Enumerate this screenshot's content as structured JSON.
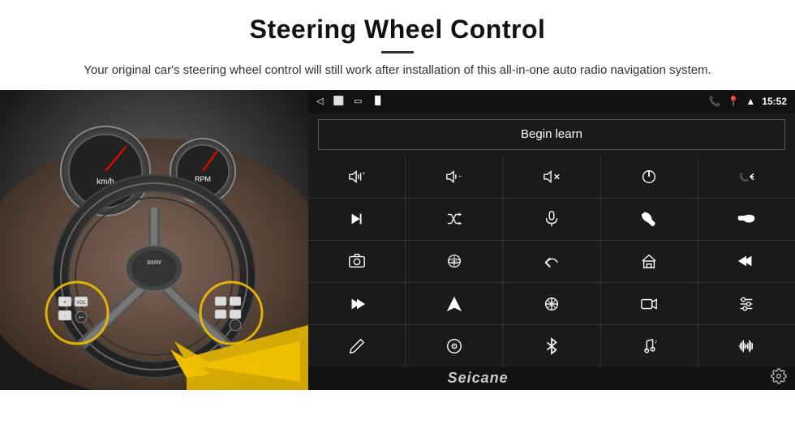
{
  "header": {
    "title": "Steering Wheel Control",
    "description": "Your original car's steering wheel control will still work after installation of this all-in-one auto radio navigation system."
  },
  "status_bar": {
    "time": "15:52",
    "back_label": "◁",
    "home_label": "⬜",
    "recent_label": "▭",
    "signal_label": "▐▌"
  },
  "begin_learn_button": "Begin learn",
  "brand": "Seicane",
  "controls": [
    {
      "row": 1,
      "col": 1,
      "icon": "vol_up",
      "unicode": "🔊+"
    },
    {
      "row": 1,
      "col": 2,
      "icon": "vol_down",
      "unicode": "🔉-"
    },
    {
      "row": 1,
      "col": 3,
      "icon": "vol_mute",
      "unicode": "🔇"
    },
    {
      "row": 1,
      "col": 4,
      "icon": "power",
      "unicode": "⏻"
    },
    {
      "row": 1,
      "col": 5,
      "icon": "prev_call",
      "unicode": "📞⏮"
    },
    {
      "row": 2,
      "col": 1,
      "icon": "next_track",
      "unicode": "⏭"
    },
    {
      "row": 2,
      "col": 2,
      "icon": "shuffle",
      "unicode": "⇌⏭"
    },
    {
      "row": 2,
      "col": 3,
      "icon": "mic",
      "unicode": "🎤"
    },
    {
      "row": 2,
      "col": 4,
      "icon": "phone",
      "unicode": "📞"
    },
    {
      "row": 2,
      "col": 5,
      "icon": "end_call",
      "unicode": "📵"
    },
    {
      "row": 3,
      "col": 1,
      "icon": "camera",
      "unicode": "📷"
    },
    {
      "row": 3,
      "col": 2,
      "icon": "360_view",
      "unicode": "360"
    },
    {
      "row": 3,
      "col": 3,
      "icon": "back",
      "unicode": "↩"
    },
    {
      "row": 3,
      "col": 4,
      "icon": "home",
      "unicode": "⌂"
    },
    {
      "row": 3,
      "col": 5,
      "icon": "skip_back",
      "unicode": "⏮⏮"
    },
    {
      "row": 4,
      "col": 1,
      "icon": "fast_forward",
      "unicode": "⏩"
    },
    {
      "row": 4,
      "col": 2,
      "icon": "navigate",
      "unicode": "◈"
    },
    {
      "row": 4,
      "col": 3,
      "icon": "equalizer",
      "unicode": "⇌"
    },
    {
      "row": 4,
      "col": 4,
      "icon": "record",
      "unicode": "📼"
    },
    {
      "row": 4,
      "col": 5,
      "icon": "sliders",
      "unicode": "⧍⧌"
    },
    {
      "row": 5,
      "col": 1,
      "icon": "pen",
      "unicode": "✏"
    },
    {
      "row": 5,
      "col": 2,
      "icon": "disc",
      "unicode": "💿"
    },
    {
      "row": 5,
      "col": 3,
      "icon": "bluetooth",
      "unicode": "✦"
    },
    {
      "row": 5,
      "col": 4,
      "icon": "music",
      "unicode": "🎵"
    },
    {
      "row": 5,
      "col": 5,
      "icon": "waveform",
      "unicode": "📊"
    }
  ]
}
